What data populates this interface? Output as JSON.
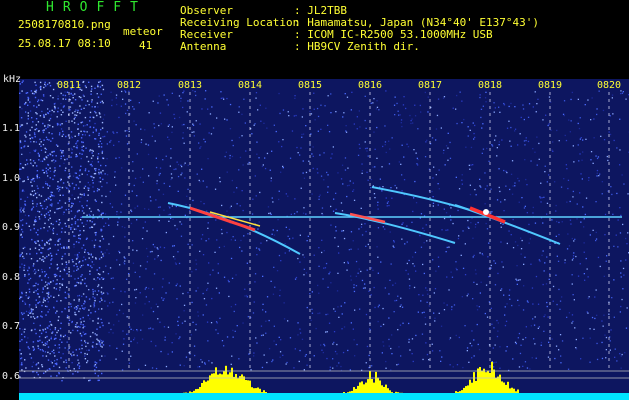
{
  "header": {
    "brand": "HROFFT",
    "filename": "2508170810.png",
    "datetime": "25.08.17 08:10",
    "meteor_label": "meteor",
    "meteor_count": "41",
    "info": [
      {
        "label": "Observer",
        "value": ": JL2TBB"
      },
      {
        "label": "Receiving Location",
        "value": ": Hamamatsu, Japan (N34°40' E137°43')"
      },
      {
        "label": "Receiver",
        "value": ": ICOM IC-R2500 53.1000MHz USB"
      },
      {
        "label": "Antenna",
        "value": ": HB9CV Zenith dir."
      }
    ]
  },
  "axes": {
    "y_unit": "kHz",
    "y_ticks": [
      "1.1",
      "1.0",
      "0.9",
      "0.8",
      "0.7",
      "0.6"
    ],
    "x_ticks": [
      "0811",
      "0812",
      "0813",
      "0814",
      "0815",
      "0816",
      "0817",
      "0818",
      "0819",
      "0820"
    ]
  },
  "colors": {
    "background": "#000000",
    "spectrum_noise": "#1a2aa8",
    "carrier": "#5fd0ff",
    "label_green": "#2fe82f",
    "label_yellow": "#ffff33",
    "level_bar": "#ffff00",
    "level_base": "#00e5ff"
  }
}
